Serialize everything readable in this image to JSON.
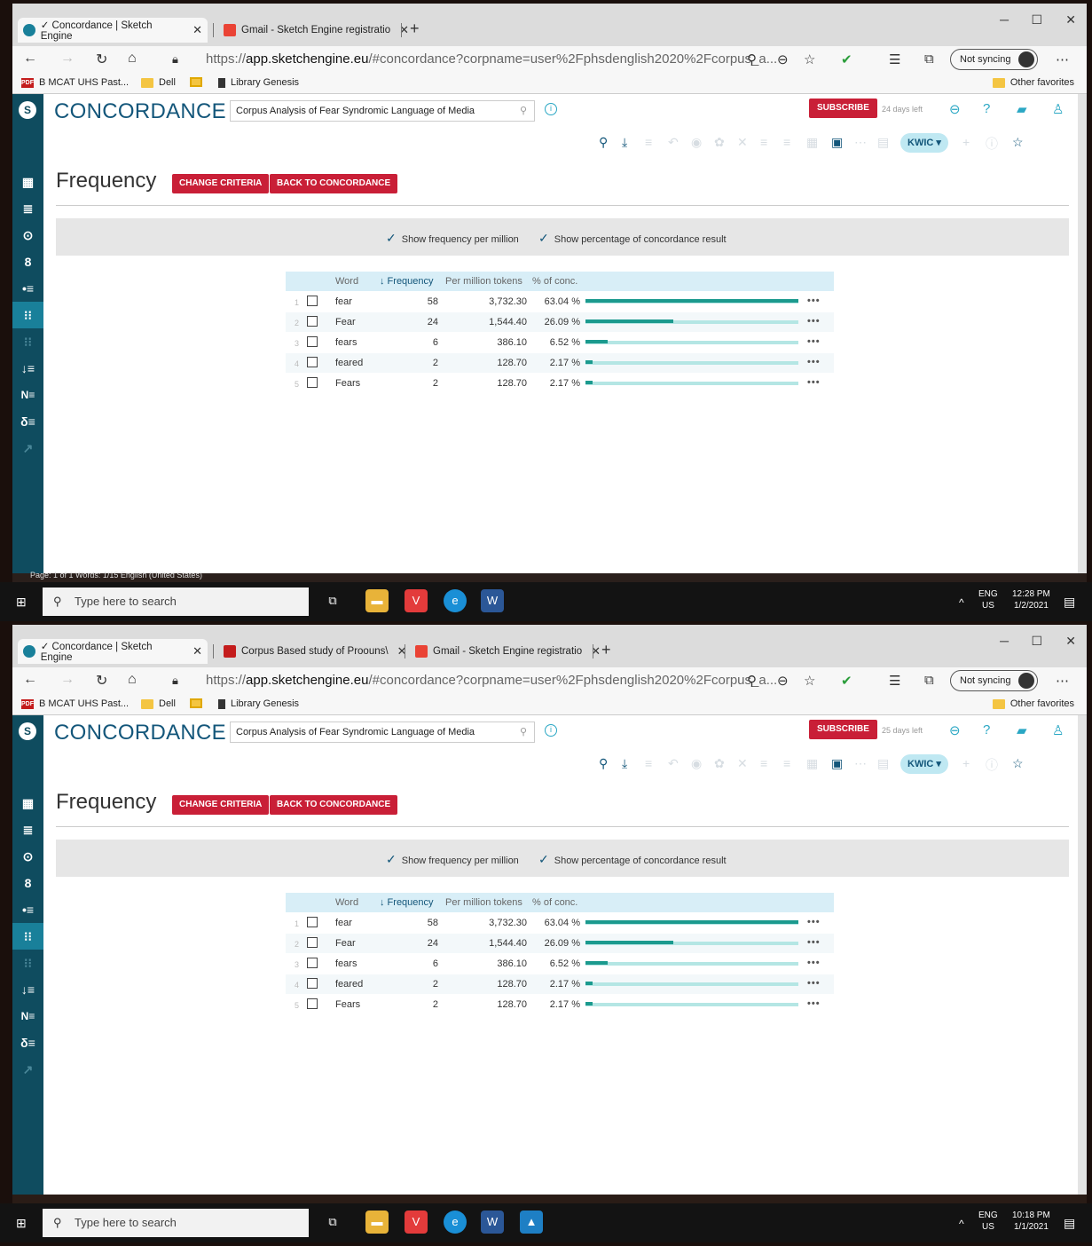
{
  "screens": [
    {
      "tabs": [
        {
          "label": "✓ Concordance | Sketch Engine",
          "close": "✕"
        },
        {
          "label": "Gmail - Sketch Engine registratio",
          "close": "✕"
        }
      ],
      "new_tab": "+",
      "url_prefix": "https://",
      "url_host": "app.sketchengine.eu",
      "url_path": "/#concordance?corpname=user%2Fphsdenglish2020%2Fcorpus_a...",
      "sync": "Not syncing",
      "favorites": [
        "B MCAT UHS Past...",
        "Dell",
        "",
        "Library Genesis"
      ],
      "other_favorites": "Other favorites",
      "app_title": "CONCORDANCE",
      "corpus_name": "Corpus Analysis of Fear Syndromic Language of Media",
      "subscribe": "SUBSCRIBE",
      "days_left": "24 days left",
      "kwic": "KWIC ▾",
      "page_title": "Frequency",
      "change_criteria": "CHANGE CRITERIA",
      "back_to_concordance": "BACK TO CONCORDANCE",
      "option1": "Show frequency per million",
      "option2": "Show percentage of concordance result",
      "columns": {
        "word": "Word",
        "frequency": "↓ Frequency",
        "per_million": "Per million tokens",
        "pct": "% of conc."
      },
      "rows": [
        {
          "n": "1",
          "word": "fear",
          "freq": "58",
          "pm": "3,732.30",
          "pct": "63.04 %",
          "frac": 1.0
        },
        {
          "n": "2",
          "word": "Fear",
          "freq": "24",
          "pm": "1,544.40",
          "pct": "26.09 %",
          "frac": 0.414
        },
        {
          "n": "3",
          "word": "fears",
          "freq": "6",
          "pm": "386.10",
          "pct": "6.52 %",
          "frac": 0.103
        },
        {
          "n": "4",
          "word": "feared",
          "freq": "2",
          "pm": "128.70",
          "pct": "2.17 %",
          "frac": 0.034
        },
        {
          "n": "5",
          "word": "Fears",
          "freq": "2",
          "pm": "128.70",
          "pct": "2.17 %",
          "frac": 0.034
        }
      ],
      "word_status": "Page: 1 of 1    Words: 1/15        English (United States)",
      "search_placeholder": "Type here to search",
      "tray_lang": "ENG",
      "tray_region": "US",
      "tray_time": "12:28 PM",
      "tray_date": "1/2/2021"
    },
    {
      "tabs": [
        {
          "label": "✓ Concordance | Sketch Engine",
          "close": "✕"
        },
        {
          "label": "Corpus Based study of Proouns\\",
          "close": "✕"
        },
        {
          "label": "Gmail - Sketch Engine registratio",
          "close": "✕"
        }
      ],
      "new_tab": "+",
      "url_prefix": "https://",
      "url_host": "app.sketchengine.eu",
      "url_path": "/#concordance?corpname=user%2Fphsdenglish2020%2Fcorpus_a...",
      "sync": "Not syncing",
      "favorites": [
        "B MCAT UHS Past...",
        "Dell",
        "",
        "Library Genesis"
      ],
      "other_favorites": "Other favorites",
      "app_title": "CONCORDANCE",
      "corpus_name": "Corpus Analysis of Fear Syndromic Language of Media",
      "subscribe": "SUBSCRIBE",
      "days_left": "25 days left",
      "kwic": "KWIC ▾",
      "page_title": "Frequency",
      "change_criteria": "CHANGE CRITERIA",
      "back_to_concordance": "BACK TO CONCORDANCE",
      "option1": "Show frequency per million",
      "option2": "Show percentage of concordance result",
      "columns": {
        "word": "Word",
        "frequency": "↓ Frequency",
        "per_million": "Per million tokens",
        "pct": "% of conc."
      },
      "rows": [
        {
          "n": "1",
          "word": "fear",
          "freq": "58",
          "pm": "3,732.30",
          "pct": "63.04 %",
          "frac": 1.0
        },
        {
          "n": "2",
          "word": "Fear",
          "freq": "24",
          "pm": "1,544.40",
          "pct": "26.09 %",
          "frac": 0.414
        },
        {
          "n": "3",
          "word": "fears",
          "freq": "6",
          "pm": "386.10",
          "pct": "6.52 %",
          "frac": 0.103
        },
        {
          "n": "4",
          "word": "feared",
          "freq": "2",
          "pm": "128.70",
          "pct": "2.17 %",
          "frac": 0.034
        },
        {
          "n": "5",
          "word": "Fears",
          "freq": "2",
          "pm": "128.70",
          "pct": "2.17 %",
          "frac": 0.034
        }
      ],
      "word_status": "",
      "search_placeholder": "Type here to search",
      "tray_lang": "ENG",
      "tray_region": "US",
      "tray_time": "10:18 PM",
      "tray_date": "1/1/2021"
    }
  ],
  "colors": {
    "sidebar": "#0f4c5f",
    "accent": "#13567a",
    "red": "#c91f37",
    "bar": "#1b9a8e",
    "bar_bg": "#b4e6e4"
  }
}
